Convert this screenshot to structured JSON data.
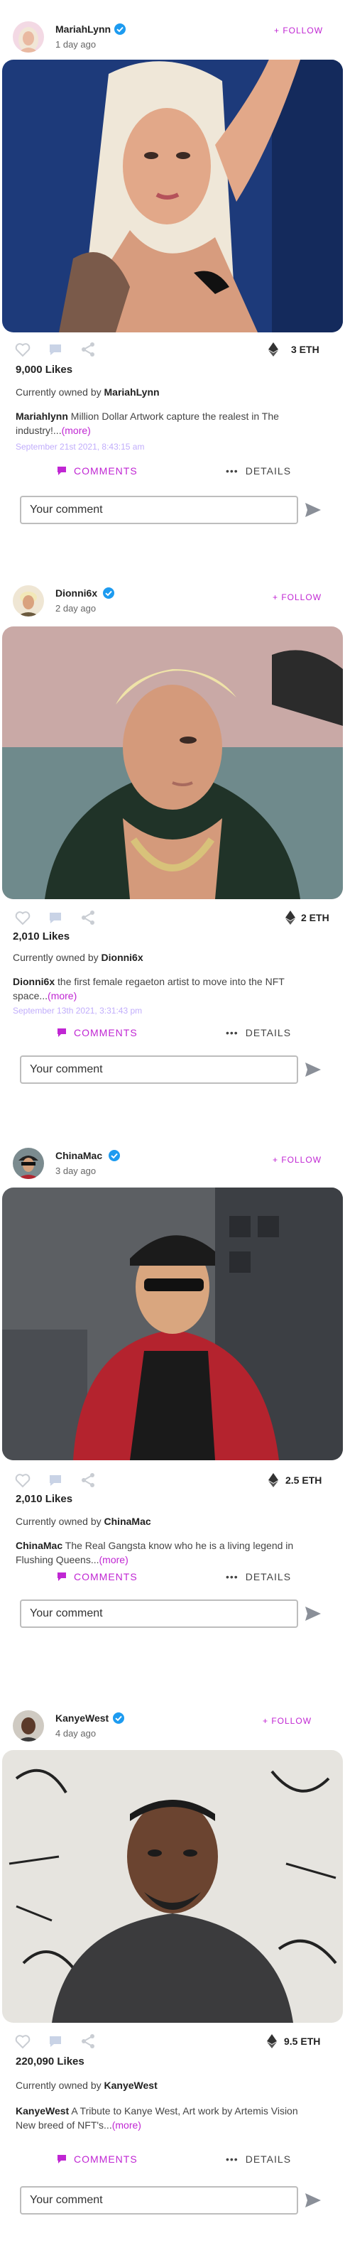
{
  "colors": {
    "accent": "#c026d3",
    "verified": "#1d9bf0",
    "icon_muted": "#c9cdd3"
  },
  "posts": [
    {
      "username": "MariahLynn",
      "age": "1 day ago",
      "follow_label": "+ FOLLOW",
      "price": "3 ETH",
      "likes": "9,000 Likes",
      "owned_prefix": "Currently owned by",
      "owner": "MariahLynn",
      "desc_user": "Mariahlynn",
      "desc_text": " Million Dollar Artwork capture the realest in The industry!...",
      "more_label": "(more)",
      "timestamp": "September 21st 2021, 8:43:15 am",
      "comments_label": "COMMENTS",
      "details_label": "DETAILS",
      "comment_placeholder": "Your comment"
    },
    {
      "username": "Dionni6x",
      "age": "2 day ago",
      "follow_label": "+ FOLLOW",
      "price": "2 ETH",
      "likes": "2,010 Likes",
      "owned_prefix": "Currently owned by",
      "owner": "Dionni6x",
      "desc_user": "Dionni6x",
      "desc_text": " the first female regaeton artist to move into the NFT space...",
      "more_label": "(more)",
      "timestamp": "September 13th 2021, 3:31:43 pm",
      "comments_label": "COMMENTS",
      "details_label": "DETAILS",
      "comment_placeholder": "Your comment"
    },
    {
      "username": "ChinaMac",
      "age": "3 day ago",
      "follow_label": "+ FOLLOW",
      "price": "2.5 ETH",
      "likes": "2,010 Likes",
      "owned_prefix": "Currently owned by",
      "owner": "ChinaMac",
      "desc_user": "ChinaMac",
      "desc_text": " The Real Gangsta know who he is a living legend in Flushing Queens...",
      "more_label": "(more)",
      "timestamp": "",
      "comments_label": "COMMENTS",
      "details_label": "DETAILS",
      "comment_placeholder": "Your comment"
    },
    {
      "username": "KanyeWest",
      "age": "4 day ago",
      "follow_label": "+ FOLLOW",
      "price": "9.5 ETH",
      "likes": "220,090 Likes",
      "owned_prefix": "Currently owned by",
      "owner": "KanyeWest",
      "desc_user": "KanyeWest",
      "desc_text": " A Tribute to Kanye West, Art work by Artemis Vision New breed of NFT's...",
      "more_label": "(more)",
      "timestamp": "",
      "comments_label": "COMMENTS",
      "details_label": "DETAILS",
      "comment_placeholder": "Your comment"
    }
  ]
}
